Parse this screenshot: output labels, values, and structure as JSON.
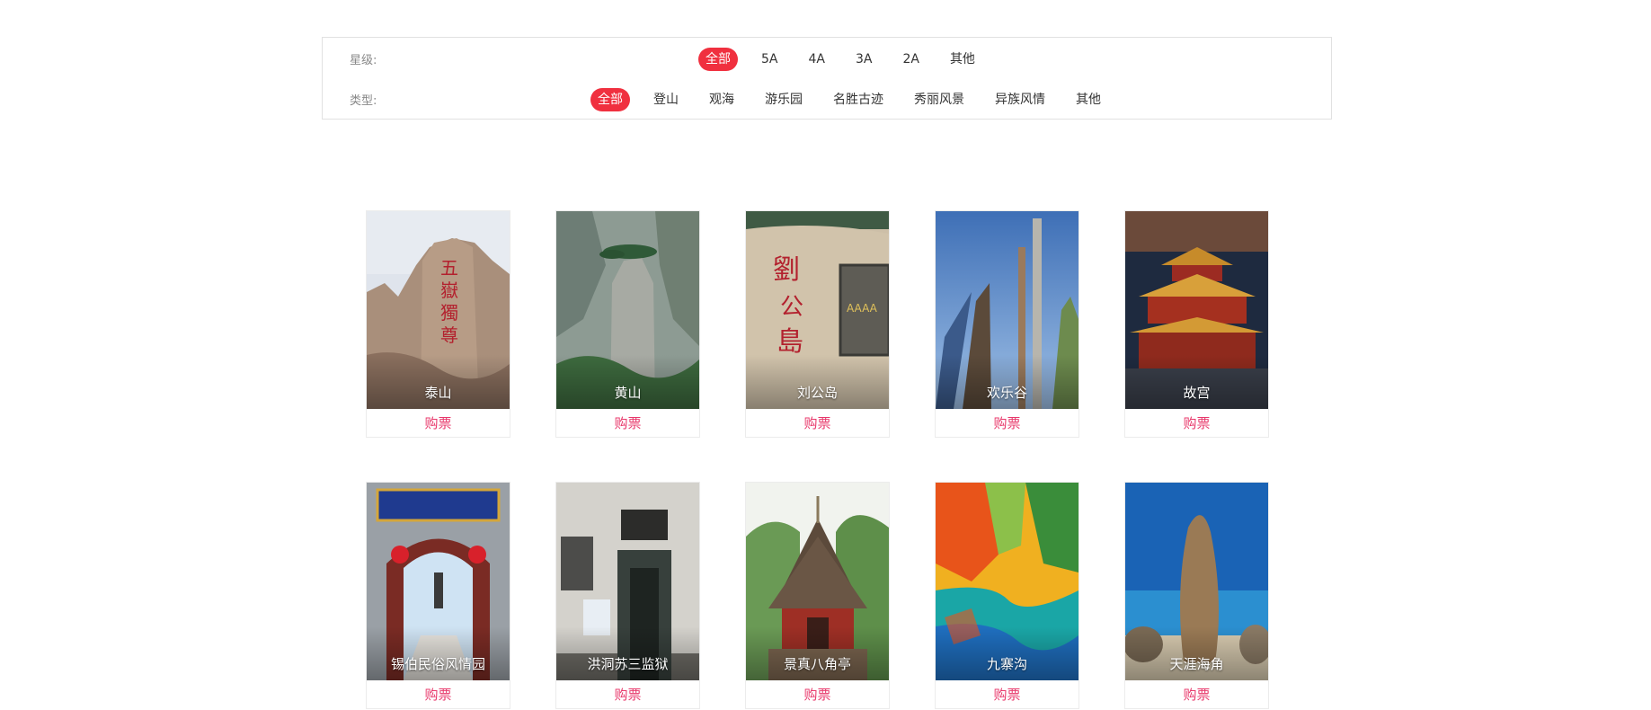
{
  "filters": {
    "star": {
      "label": "星级:",
      "options": [
        "全部",
        "5A",
        "4A",
        "3A",
        "2A",
        "其他"
      ],
      "selected": "全部"
    },
    "type": {
      "label": "类型:",
      "options": [
        "全部",
        "登山",
        "观海",
        "游乐园",
        "名胜古迹",
        "秀丽风景",
        "异族风情",
        "其他"
      ],
      "selected": "全部"
    }
  },
  "attractions": [
    {
      "name": "泰山",
      "buy": "购票"
    },
    {
      "name": "黄山",
      "buy": "购票"
    },
    {
      "name": "刘公岛",
      "buy": "购票"
    },
    {
      "name": "欢乐谷",
      "buy": "购票"
    },
    {
      "name": "故宫",
      "buy": "购票"
    },
    {
      "name": "锡伯民俗风情园",
      "buy": "购票"
    },
    {
      "name": "洪洞苏三监狱",
      "buy": "购票"
    },
    {
      "name": "景真八角亭",
      "buy": "购票"
    },
    {
      "name": "九寨沟",
      "buy": "购票"
    },
    {
      "name": "天涯海角",
      "buy": "购票"
    }
  ],
  "colors": {
    "accent": "#f0303f",
    "buy_text": "#e8386b"
  }
}
